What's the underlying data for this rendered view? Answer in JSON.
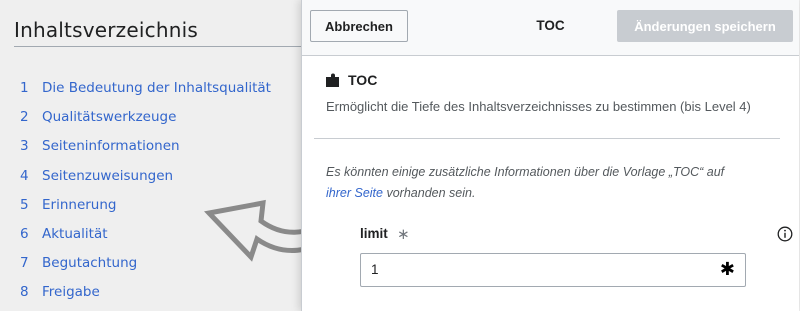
{
  "background": {
    "heading": "Inhaltsverzeichnis",
    "toc_items": [
      {
        "number": "1",
        "label": "Die Bedeutung der Inhaltsqualität"
      },
      {
        "number": "2",
        "label": "Qualitätswerkzeuge"
      },
      {
        "number": "3",
        "label": "Seiteninformationen"
      },
      {
        "number": "4",
        "label": "Seitenzuweisungen"
      },
      {
        "number": "5",
        "label": "Erinnerung"
      },
      {
        "number": "6",
        "label": "Aktualität"
      },
      {
        "number": "7",
        "label": "Begutachtung"
      },
      {
        "number": "8",
        "label": "Freigabe"
      }
    ],
    "link_color": "#3366cc",
    "arrow_icon": "curved-arrow-icon"
  },
  "dialog": {
    "cancel_label": "Abbrechen",
    "title": "TOC",
    "save_label": "Änderungen speichern",
    "save_disabled": true,
    "template_icon": "puzzle-piece-icon",
    "template_name": "TOC",
    "template_description": "Ermöglicht die Tiefe des Inhaltsverzeichnisses zu bestimmen (bis Level 4)",
    "note_prefix": "Es könnten einige zusätzliche Informationen über die Vorlage „TOC“ auf",
    "note_link": "ihrer Seite",
    "note_suffix": "vorhanden sein.",
    "parameter": {
      "name": "limit",
      "required_marker": "∗",
      "info_icon": "info-icon",
      "value": "1",
      "input_icon": "asterisk-icon"
    }
  },
  "colors": {
    "accent": "#3366cc",
    "disabled_button": "#c8ccd1",
    "text": "#202122",
    "muted_text": "#54595d"
  }
}
